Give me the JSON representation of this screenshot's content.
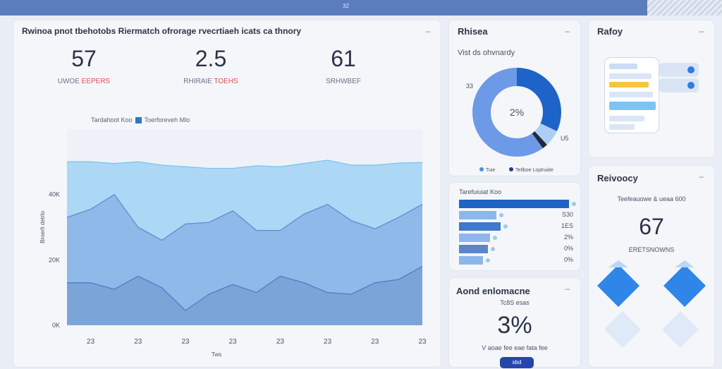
{
  "topbar": {
    "mark": "32"
  },
  "main": {
    "title": "Rwinoa pnot tbehotobs Riermatch ofrorage rvecrtiaeh icats ca thnory",
    "metrics": [
      {
        "value": "57",
        "label_a": "UWOE",
        "label_b": "EEPERS"
      },
      {
        "value": "2.5",
        "label_a": "RHIRAIE",
        "label_b": "TOEHS"
      },
      {
        "value": "61",
        "label_a": "SRHWBEF",
        "label_b": ""
      }
    ],
    "legend_a": "Tardahoot Koo",
    "legend_b": "Toerforeveh Mlo",
    "ylabel": "Broerlt detrlo",
    "xlabel": "Tws"
  },
  "chart_data": {
    "type": "area",
    "x": [
      "",
      "23",
      "",
      "23",
      "",
      "23",
      "",
      "23",
      "",
      "23",
      "",
      "23",
      "",
      "23",
      "",
      "23"
    ],
    "ylim": [
      0,
      600
    ],
    "yticks": [
      "0K",
      "20K",
      "40K"
    ],
    "series": [
      {
        "name": "Tardahoot Koo",
        "values": [
          500,
          500,
          495,
          500,
          490,
          485,
          480,
          480,
          488,
          485,
          495,
          505,
          490,
          490,
          496,
          498
        ]
      },
      {
        "name": "Toerforeveh Mlo",
        "values": [
          330,
          355,
          400,
          300,
          260,
          310,
          315,
          350,
          290,
          290,
          340,
          370,
          320,
          295,
          330,
          370
        ]
      },
      {
        "name": "",
        "values": [
          130,
          130,
          110,
          150,
          115,
          45,
          95,
          125,
          100,
          150,
          130,
          100,
          95,
          130,
          140,
          180
        ]
      }
    ]
  },
  "donut": {
    "title": "Rhisea",
    "subtitle": "Vist ds ohvnardy",
    "center": "2%",
    "left_label": "33",
    "right_label": "U5",
    "legend_a": "Tuie",
    "legend_b": "Tetlboe Loptruide",
    "slices": [
      0.32,
      0.06,
      0.02,
      0.6
    ],
    "colors": [
      "#1e63c7",
      "#aecff3",
      "#1d2a3f",
      "#6d9ae6"
    ]
  },
  "bars": {
    "title": "Tarefuiuiat Koo",
    "rows": [
      {
        "value": 1.0,
        "label": ""
      },
      {
        "value": 0.34,
        "label": "S30"
      },
      {
        "value": 0.38,
        "label": "1ES"
      },
      {
        "value": 0.28,
        "label": "2%"
      },
      {
        "value": 0.26,
        "label": "0%"
      },
      {
        "value": 0.22,
        "label": "0%"
      }
    ]
  },
  "pct": {
    "title": "Aond enlomacne",
    "sub": "Tc8S esas",
    "value": "3%",
    "caption": "V aoae fee eae fata fee",
    "button": "sbd"
  },
  "phone_card": {
    "title": "Rafoy"
  },
  "score": {
    "title": "Reivoocy",
    "sub": "Teefeauowe & ueaa 600",
    "value": "67",
    "caption": "ERETSNOWNS"
  }
}
